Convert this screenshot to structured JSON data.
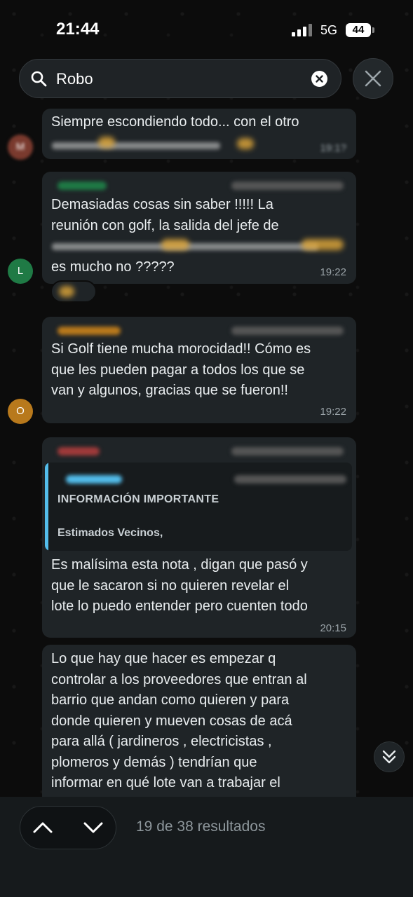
{
  "status_bar": {
    "time": "21:44",
    "network": "5G",
    "battery": "44"
  },
  "search": {
    "query": "Robo"
  },
  "messages": [
    {
      "text": "Siempre escondiendo todo... con el otro",
      "time": "19:1?",
      "avatar_initial": "M"
    },
    {
      "text": "Demasiadas cosas sin saber !!!!! La\nreunión con golf,  la salida del jefe de",
      "text_end": "es mucho no ?????",
      "time": "19:22",
      "avatar_initial": "L",
      "avatar_color": "#1f7a45"
    },
    {
      "text": "Si Golf tiene mucha morocidad!! Cómo es\nque les pueden pagar a todos los que se\nvan y algunos, gracias que se fueron!!",
      "time": "19:22",
      "avatar_initial": "O",
      "avatar_color": "#b8791c"
    },
    {
      "quote_title": "INFORMACIÓN IMPORTANTE",
      "quote_body": "Estimados Vecinos,",
      "text": "Es malísima  esta nota , digan que pasó y\nque le sacaron si no quieren revelar el\nlote lo puedo entender pero cuenten todo",
      "time": "20:15"
    },
    {
      "text": "Lo que hay que hacer es empezar q\ncontrolar a los proveedores que entran al\nbarrio que andan como quieren y para\ndonde quieren y mueven cosas de acá\npara allá ( jardineros , electricistas ,\nplomeros y demás ) tendrían que\ninformar en qué lote van a trabajar el"
    }
  ],
  "footer": {
    "results": "19 de 38 resultados"
  },
  "colors": {
    "accent_quote": "#53bdeb",
    "bubble": "#1f2427"
  }
}
